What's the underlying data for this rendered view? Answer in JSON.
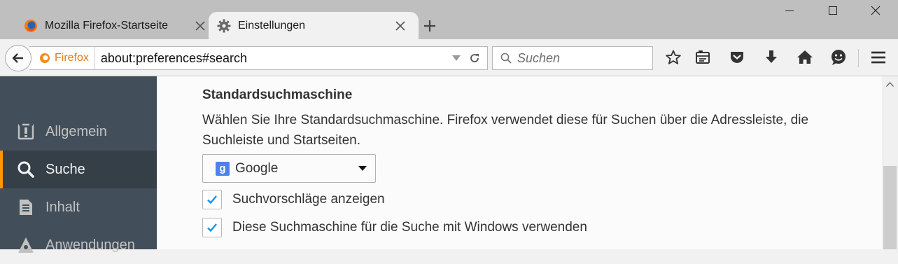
{
  "tabs": [
    {
      "title": "Mozilla Firefox-Startseite",
      "icon": "firefox-icon",
      "active": false
    },
    {
      "title": "Einstellungen",
      "icon": "gear-icon",
      "active": true
    }
  ],
  "navbar": {
    "identity_label": "Firefox",
    "url": "about:preferences#search",
    "search_placeholder": "Suchen"
  },
  "sidebar": {
    "items": [
      {
        "label": "Allgemein",
        "icon": "general-icon"
      },
      {
        "label": "Suche",
        "icon": "search-icon",
        "selected": true
      },
      {
        "label": "Inhalt",
        "icon": "content-icon"
      },
      {
        "label": "Anwendungen",
        "icon": "applications-icon"
      }
    ]
  },
  "content": {
    "heading": "Standardsuchmaschine",
    "description": "Wählen Sie Ihre Standardsuchmaschine. Firefox verwendet diese für Suchen über die Adressleiste, die Suchleiste und Startseiten.",
    "engine": {
      "label": "Google",
      "logo_letter": "g"
    },
    "checkboxes": [
      {
        "label": "Suchvorschläge anzeigen",
        "checked": true
      },
      {
        "label": "Diese Suchmaschine für die Suche mit Windows verwenden",
        "checked": true
      }
    ]
  },
  "colors": {
    "accent": "#ff9500",
    "sidebar_bg": "#424f5a",
    "checkmark": "#0996f8"
  }
}
